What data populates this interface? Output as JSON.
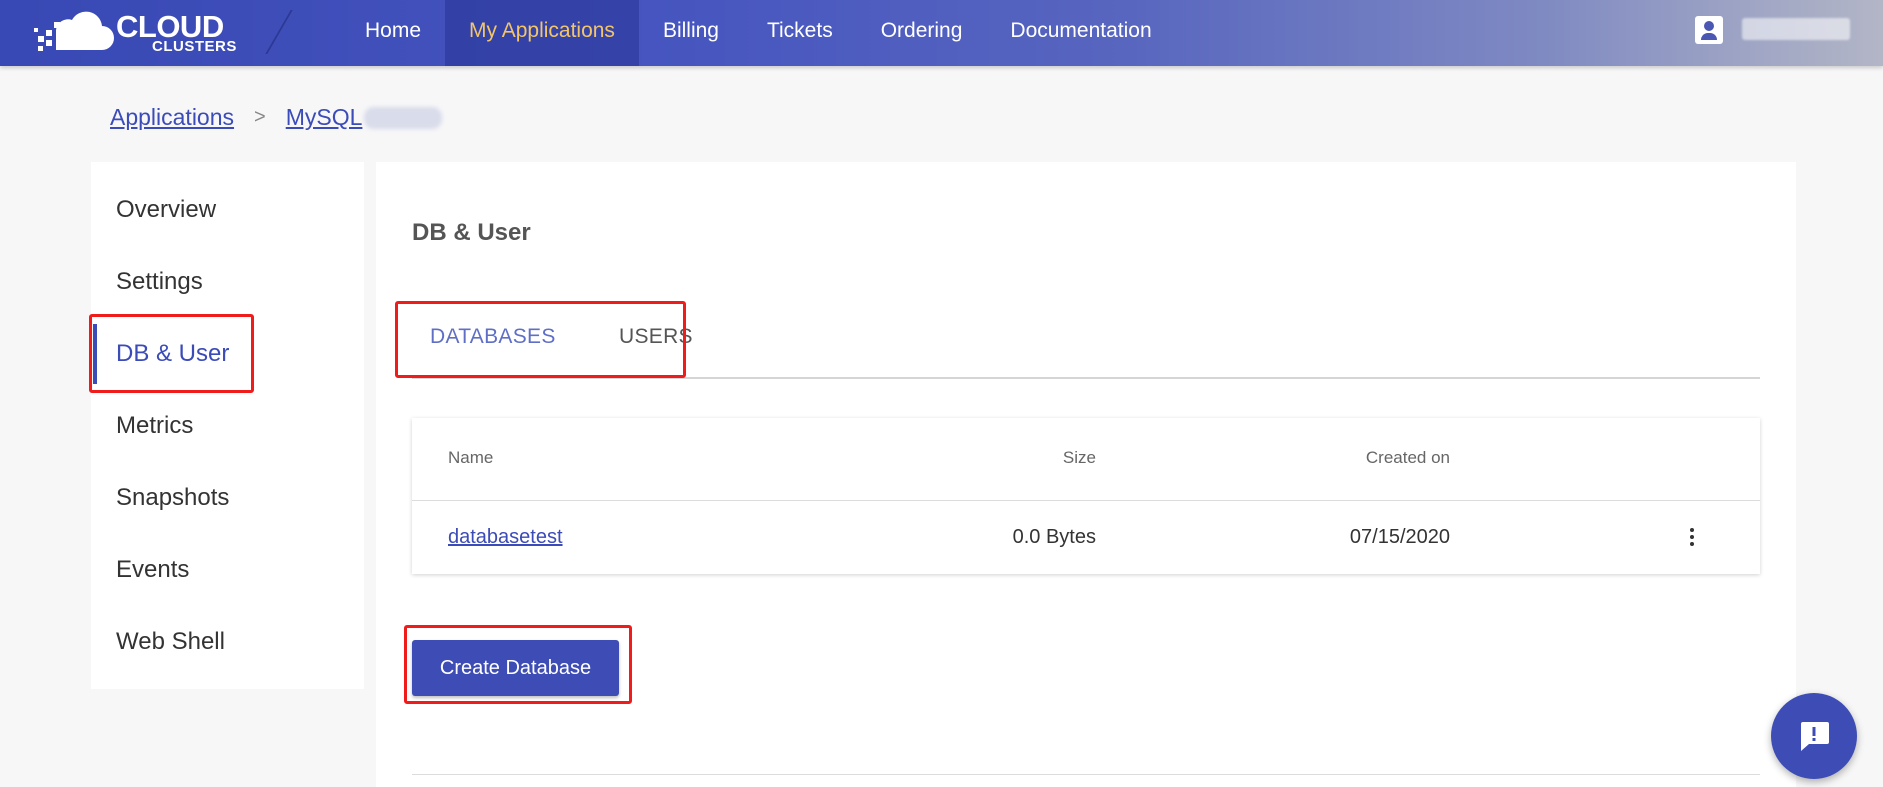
{
  "logo": {
    "line1": "CLOUD",
    "line2": "CLUSTERS"
  },
  "nav": {
    "items": [
      {
        "label": "Home"
      },
      {
        "label": "My Applications",
        "active": true
      },
      {
        "label": "Billing"
      },
      {
        "label": "Tickets"
      },
      {
        "label": "Ordering"
      },
      {
        "label": "Documentation"
      }
    ]
  },
  "breadcrumb": {
    "root": "Applications",
    "separator": ">",
    "current": "MySQL"
  },
  "sidebar": {
    "items": [
      {
        "label": "Overview"
      },
      {
        "label": "Settings"
      },
      {
        "label": "DB & User",
        "active": true
      },
      {
        "label": "Metrics"
      },
      {
        "label": "Snapshots"
      },
      {
        "label": "Events"
      },
      {
        "label": "Web Shell"
      }
    ]
  },
  "main": {
    "title": "DB & User",
    "tabs": [
      {
        "label": "DATABASES",
        "active": true
      },
      {
        "label": "USERS"
      }
    ],
    "table": {
      "columns": [
        "Name",
        "Size",
        "Created on"
      ],
      "rows": [
        {
          "name": "databasetest",
          "size": "0.0 Bytes",
          "created_on": "07/15/2020"
        }
      ]
    },
    "create_button": "Create Database"
  },
  "colors": {
    "brand": "#3d4db5",
    "nav_active_text": "#f2c56a",
    "highlight": "#f01c1c"
  },
  "icons": [
    "user-icon",
    "more-vert-icon",
    "chat-alert-icon",
    "cloud-logo-icon"
  ]
}
